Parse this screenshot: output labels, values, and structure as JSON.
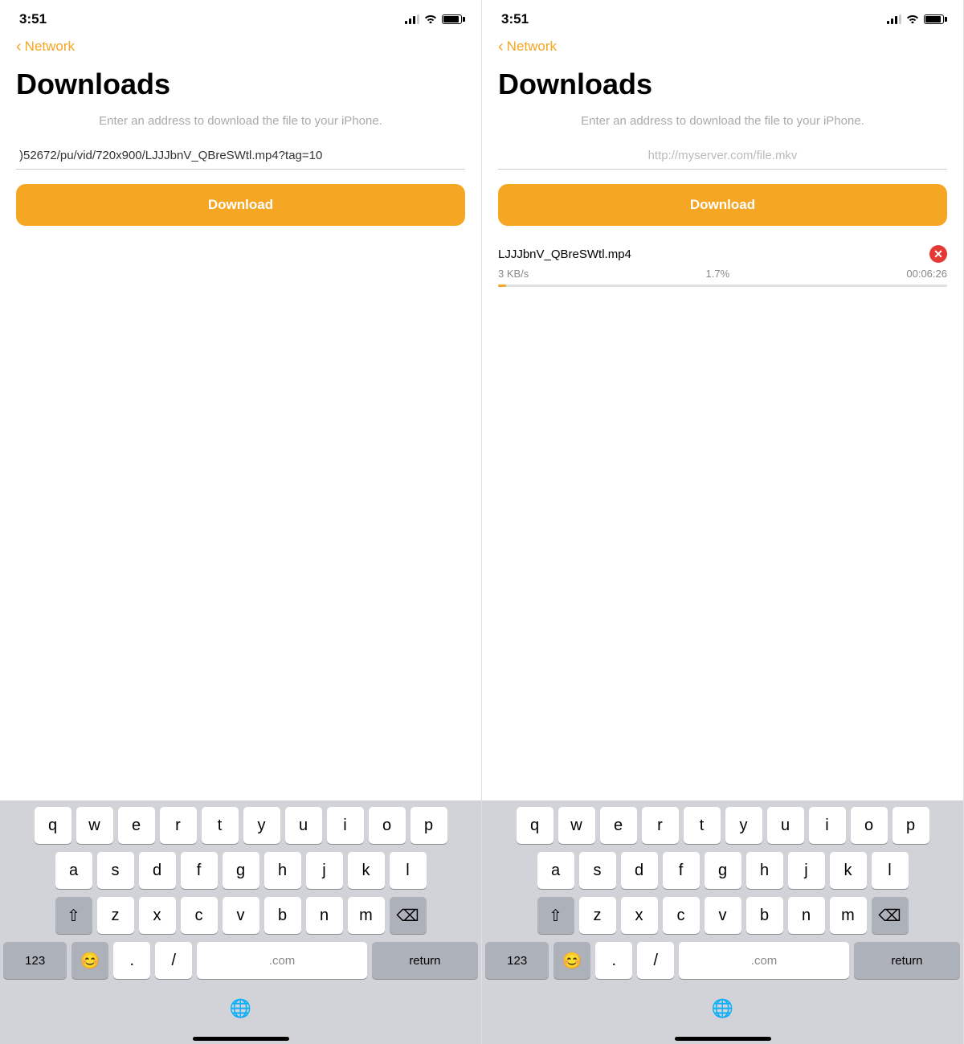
{
  "left": {
    "status": {
      "time": "3:51"
    },
    "nav": {
      "back_label": "Network"
    },
    "page": {
      "title": "Downloads",
      "subtitle": "Enter an address to download the file to your iPhone.",
      "url_value": ")52672/pu/vid/720x900/LJJJbnV_QBreSWtl.mp4?tag=10",
      "url_placeholder": "http://myserver.com/file.mkv",
      "download_btn": "Download"
    }
  },
  "right": {
    "status": {
      "time": "3:51"
    },
    "nav": {
      "back_label": "Network"
    },
    "page": {
      "title": "Downloads",
      "subtitle": "Enter an address to download the file to your iPhone.",
      "url_value": "",
      "url_placeholder": "http://myserver.com/file.mkv",
      "download_btn": "Download"
    },
    "download_item": {
      "filename": "LJJJbnV_QBreSWtl.mp4",
      "speed": "3 KB/s",
      "percent": "1.7%",
      "time_remaining": "00:06:26",
      "progress": 1.7
    }
  },
  "keyboard": {
    "rows": [
      [
        "q",
        "w",
        "e",
        "r",
        "t",
        "y",
        "u",
        "i",
        "o",
        "p"
      ],
      [
        "a",
        "s",
        "d",
        "f",
        "g",
        "h",
        "j",
        "k",
        "l"
      ],
      [
        "z",
        "x",
        "c",
        "v",
        "b",
        "n",
        "m"
      ],
      [
        "123",
        "😊",
        ".",
        "/",
        " .com",
        "return"
      ]
    ]
  },
  "icons": {
    "back": "❮",
    "cancel": "✕",
    "globe": "🌐",
    "shift": "⇧",
    "backspace": "⌫"
  }
}
